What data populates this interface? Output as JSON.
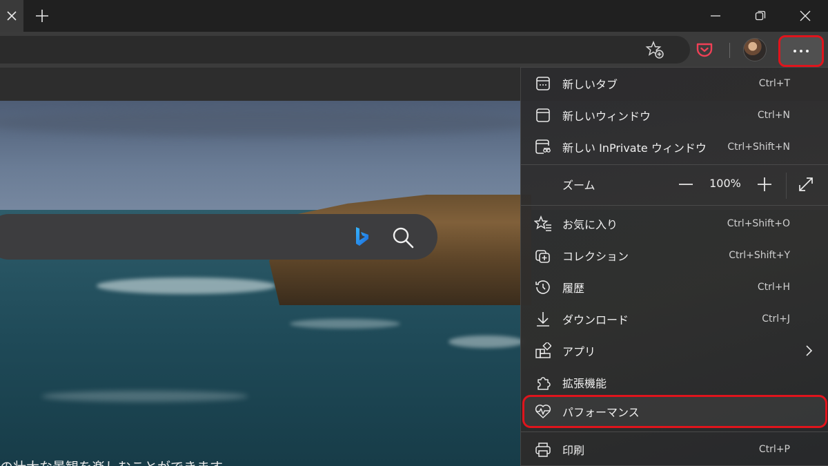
{
  "window": {
    "colors": {
      "highlight": "#e0141c",
      "menu_bg": "#2c2c2e",
      "toolbar": "#3b3b3b"
    },
    "icons": [
      "close-icon",
      "plus-icon",
      "minimize-icon",
      "restore-icon",
      "favorite-add-icon",
      "pocket-icon",
      "more-icon"
    ]
  },
  "page": {
    "caption": "の壮大な景観を楽しむことができます"
  },
  "menu": {
    "items": [
      {
        "label": "新しいタブ",
        "shortcut": "Ctrl+T",
        "icon": "new-tab-icon"
      },
      {
        "label": "新しいウィンドウ",
        "shortcut": "Ctrl+N",
        "icon": "new-window-icon"
      },
      {
        "label": "新しい InPrivate ウィンドウ",
        "shortcut": "Ctrl+Shift+N",
        "icon": "inprivate-icon"
      },
      {
        "label": "お気に入り",
        "shortcut": "Ctrl+Shift+O",
        "icon": "favorites-icon"
      },
      {
        "label": "コレクション",
        "shortcut": "Ctrl+Shift+Y",
        "icon": "collections-icon"
      },
      {
        "label": "履歴",
        "shortcut": "Ctrl+H",
        "icon": "history-icon"
      },
      {
        "label": "ダウンロード",
        "shortcut": "Ctrl+J",
        "icon": "download-icon"
      },
      {
        "label": "アプリ",
        "shortcut": "",
        "icon": "apps-icon"
      },
      {
        "label": "拡張機能",
        "shortcut": "",
        "icon": "extensions-icon"
      },
      {
        "label": "パフォーマンス",
        "shortcut": "",
        "icon": "performance-icon"
      },
      {
        "label": "印刷",
        "shortcut": "Ctrl+P",
        "icon": "print-icon"
      }
    ],
    "zoom": {
      "label": "ズーム",
      "value": "100%"
    }
  }
}
